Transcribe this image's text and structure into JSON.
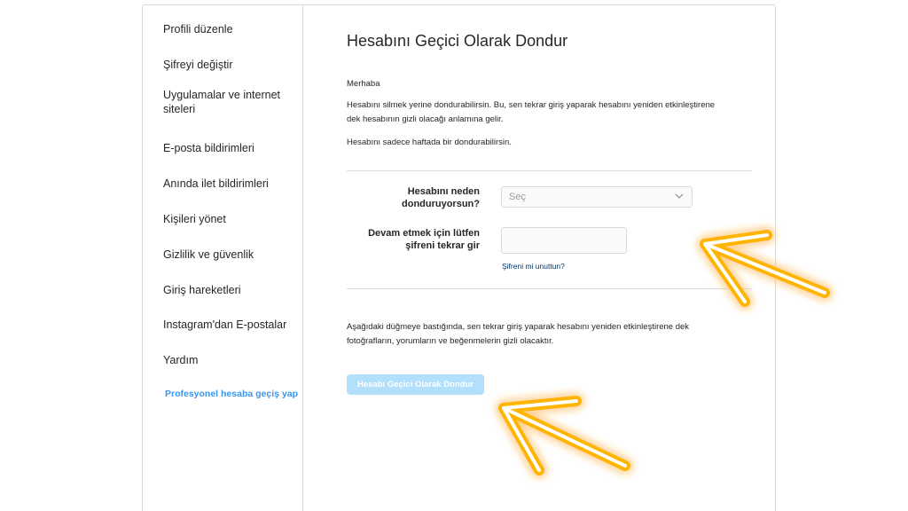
{
  "sidebar": {
    "items": [
      {
        "label": "Profili düzenle"
      },
      {
        "label": "Şifreyi değiştir"
      },
      {
        "label": "Uygulamalar ve internet siteleri"
      },
      {
        "label": "E-posta bildirimleri"
      },
      {
        "label": "Anında ilet bildirimleri"
      },
      {
        "label": "Kişileri yönet"
      },
      {
        "label": "Gizlilik ve güvenlik"
      },
      {
        "label": "Giriş hareketleri"
      },
      {
        "label": "Instagram'dan E-postalar"
      },
      {
        "label": "Yardım"
      },
      {
        "label": "Profesyonel hesaba geçiş yap"
      }
    ]
  },
  "main": {
    "title": "Hesabını Geçici Olarak Dondur",
    "greeting": "Merhaba",
    "intro": "Hesabını silmek yerine dondurabilirsin. Bu, sen tekrar giriş yaparak hesabını yeniden etkinleştirene dek hesabının gizli olacağı anlamına gelir.",
    "limit_note": "Hesabını sadece haftada bir dondurabilirsin.",
    "reason_label": "Hesabını neden donduruyorsun?",
    "reason_placeholder": "Seç",
    "password_label": "Devam etmek için lütfen şifreni tekrar gir",
    "password_value": "",
    "forgot_link": "Şifreni mi unuttun?",
    "confirm_text": "Aşağıdaki düğmeye bastığında, sen tekrar giriş yaparak hesabını yeniden etkinleştirene dek fotoğrafların, yorumların ve beğenmelerin gizli olacaktır.",
    "submit_label": "Hesabı Geçici Olarak Dondur"
  },
  "colors": {
    "link_blue": "#3897f0",
    "button_disabled": "#b2dffc",
    "arrow_glow": "#ffb400"
  }
}
